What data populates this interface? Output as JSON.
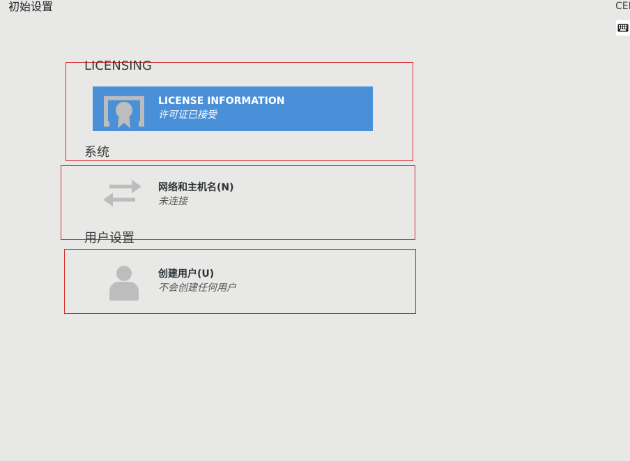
{
  "window": {
    "title": "初始设置",
    "top_right_label": "CEN",
    "keyboard_icon": "keyboard-icon"
  },
  "sections": {
    "licensing": {
      "title": "LICENSING",
      "spokes": [
        {
          "title": "LICENSE INFORMATION",
          "status": "许可证已接受",
          "icon": "license-certificate-icon",
          "selected": true
        }
      ]
    },
    "system": {
      "title": "系统",
      "spokes": [
        {
          "title": "网络和主机名(N)",
          "status": "未连接",
          "icon": "network-arrows-icon"
        }
      ]
    },
    "user_settings": {
      "title": "用户设置",
      "spokes": [
        {
          "title": "创建用户(U)",
          "status": "不会创建任何用户",
          "icon": "user-icon"
        }
      ]
    }
  },
  "colors": {
    "background": "#e8e8e7",
    "selected_spoke": "#4a90d9",
    "icon_gray": "#bdbdbd",
    "outline_red": "#d62c2c"
  }
}
